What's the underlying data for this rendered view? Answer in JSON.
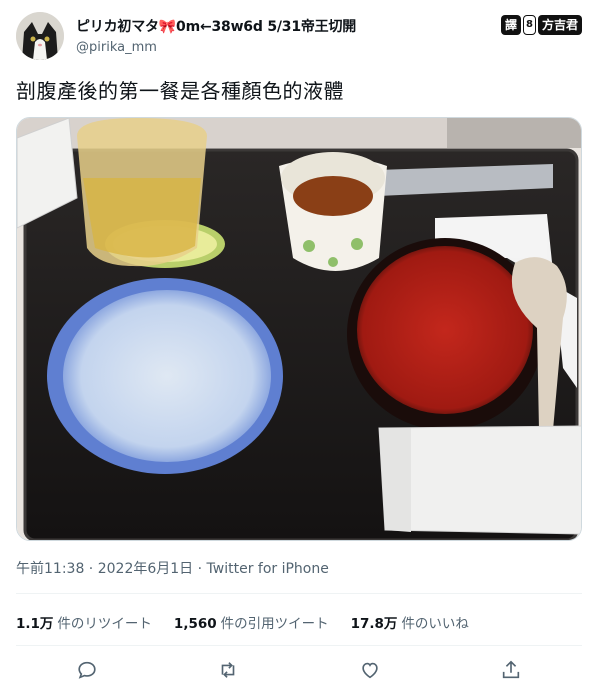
{
  "user": {
    "display_name": "ピリカ初マタ🎀0m←38w6d 5/31帝王切開",
    "handle": "@pirika_mm"
  },
  "badge": {
    "left": "譯",
    "mid": "8",
    "right": "方吉君"
  },
  "tweet": {
    "text": "剖腹產後的第一餐是各種顏色的液體"
  },
  "meta": {
    "time": "午前11:38",
    "date": "2022年6月1日",
    "source": "Twitter for iPhone",
    "sep": " · "
  },
  "stats": [
    {
      "value": "1.1万",
      "label": "件のリツイート"
    },
    {
      "value": "1,560",
      "label": "件の引用ツイート"
    },
    {
      "value": "17.8万",
      "label": "件のいいね"
    }
  ],
  "icons": [
    "reply-icon",
    "retweet-icon",
    "like-icon",
    "share-icon"
  ],
  "colors": {
    "text": "#0f1419",
    "secondary": "#536471",
    "border": "#eff3f4"
  }
}
